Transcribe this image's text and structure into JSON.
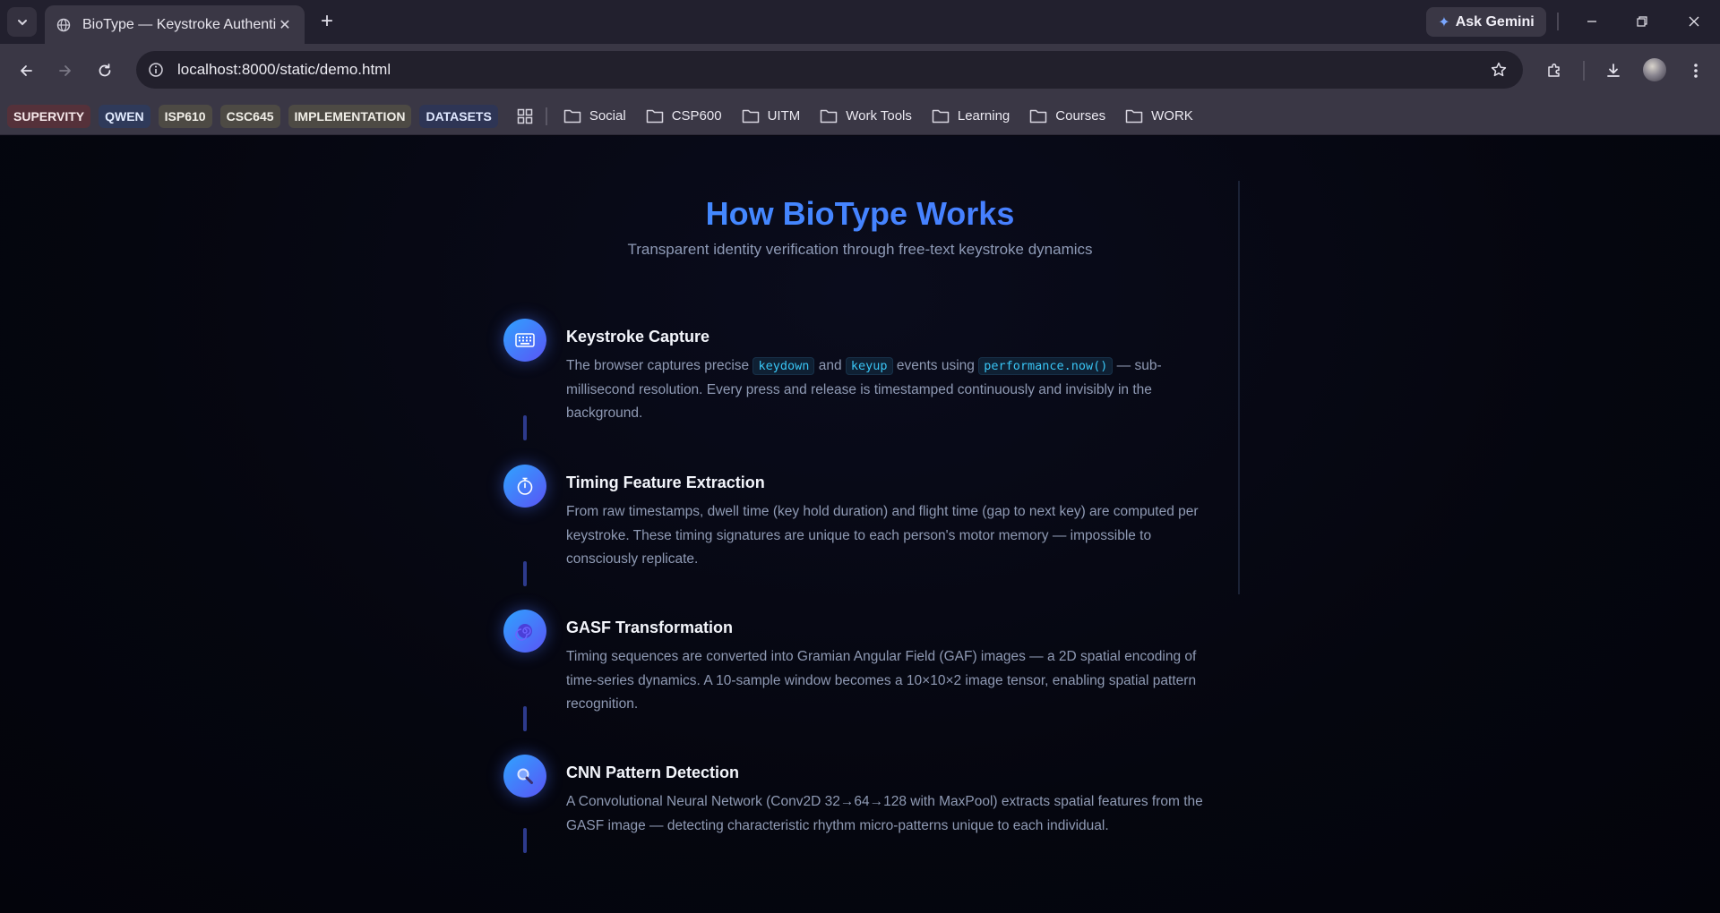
{
  "browser": {
    "tab_title": "BioType — Keystroke Authentic",
    "url": "localhost:8000/static/demo.html",
    "gemini_label": "Ask Gemini",
    "bookmark_chips": [
      "SUPERVITY",
      "QWEN",
      "ISP610",
      "CSC645",
      "IMPLEMENTATION",
      "DATASETS"
    ],
    "folders": [
      "Social",
      "CSP600",
      "UITM",
      "Work Tools",
      "Learning",
      "Courses",
      "WORK"
    ]
  },
  "page": {
    "title": "How BioType Works",
    "subtitle": "Transparent identity verification through free-text keystroke dynamics",
    "steps": [
      {
        "icon": "keyboard-icon",
        "title": "Keystroke Capture",
        "text_1": "The browser captures precise",
        "code_1": "keydown",
        "text_2": "and",
        "code_2": "keyup",
        "text_3": "events using",
        "code_3": "performance.now()",
        "text_4": "— sub-millisecond resolution. Every press and release is timestamped continuously and invisibly in the background."
      },
      {
        "icon": "stopwatch-icon",
        "title": "Timing Feature Extraction",
        "text": "From raw timestamps, dwell time (key hold duration) and flight time (gap to next key) are computed per keystroke. These timing signatures are unique to each person's motor memory — impossible to consciously replicate."
      },
      {
        "icon": "swirl-icon",
        "title": "GASF Transformation",
        "text": "Timing sequences are converted into Gramian Angular Field (GAF) images — a 2D spatial encoding of time-series dynamics. A 10-sample window becomes a 10×10×2 image tensor, enabling spatial pattern recognition."
      },
      {
        "icon": "magnifier-icon",
        "title": "CNN Pattern Detection",
        "text": "A Convolutional Neural Network (Conv2D 32→64→128 with MaxPool) extracts spatial features from the GASF image — detecting characteristic rhythm micro-patterns unique to each individual."
      }
    ]
  },
  "colors": {
    "accent_start": "#3b9dff",
    "accent_end": "#4f6bff",
    "code_text": "#39c5f5",
    "background": "#05060f"
  }
}
